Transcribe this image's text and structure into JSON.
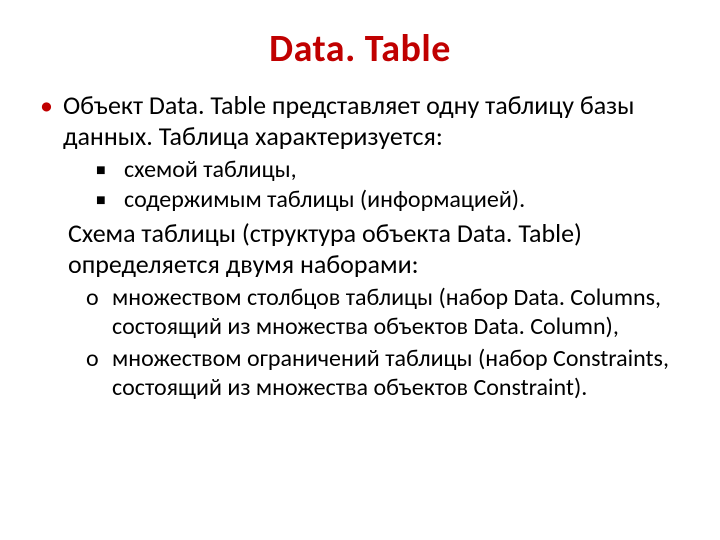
{
  "title": "Data. Table",
  "intro": "Объект Data. Table представляет одну таблицу базы данных. Таблица характеризуется:",
  "subitems": [
    "схемой таблицы,",
    "содержимым таблицы (информацией)."
  ],
  "para2": " Схема таблицы (структура объекта Data. Table) определяется двумя наборами:",
  "subitems2": [
    "множеством столбцов таблицы (набор Data. Columns, состоящий из множества объектов Data. Column),",
    "множеством ограничений таблицы (набор Constraints, состоящий из множества объектов Constraint)."
  ]
}
